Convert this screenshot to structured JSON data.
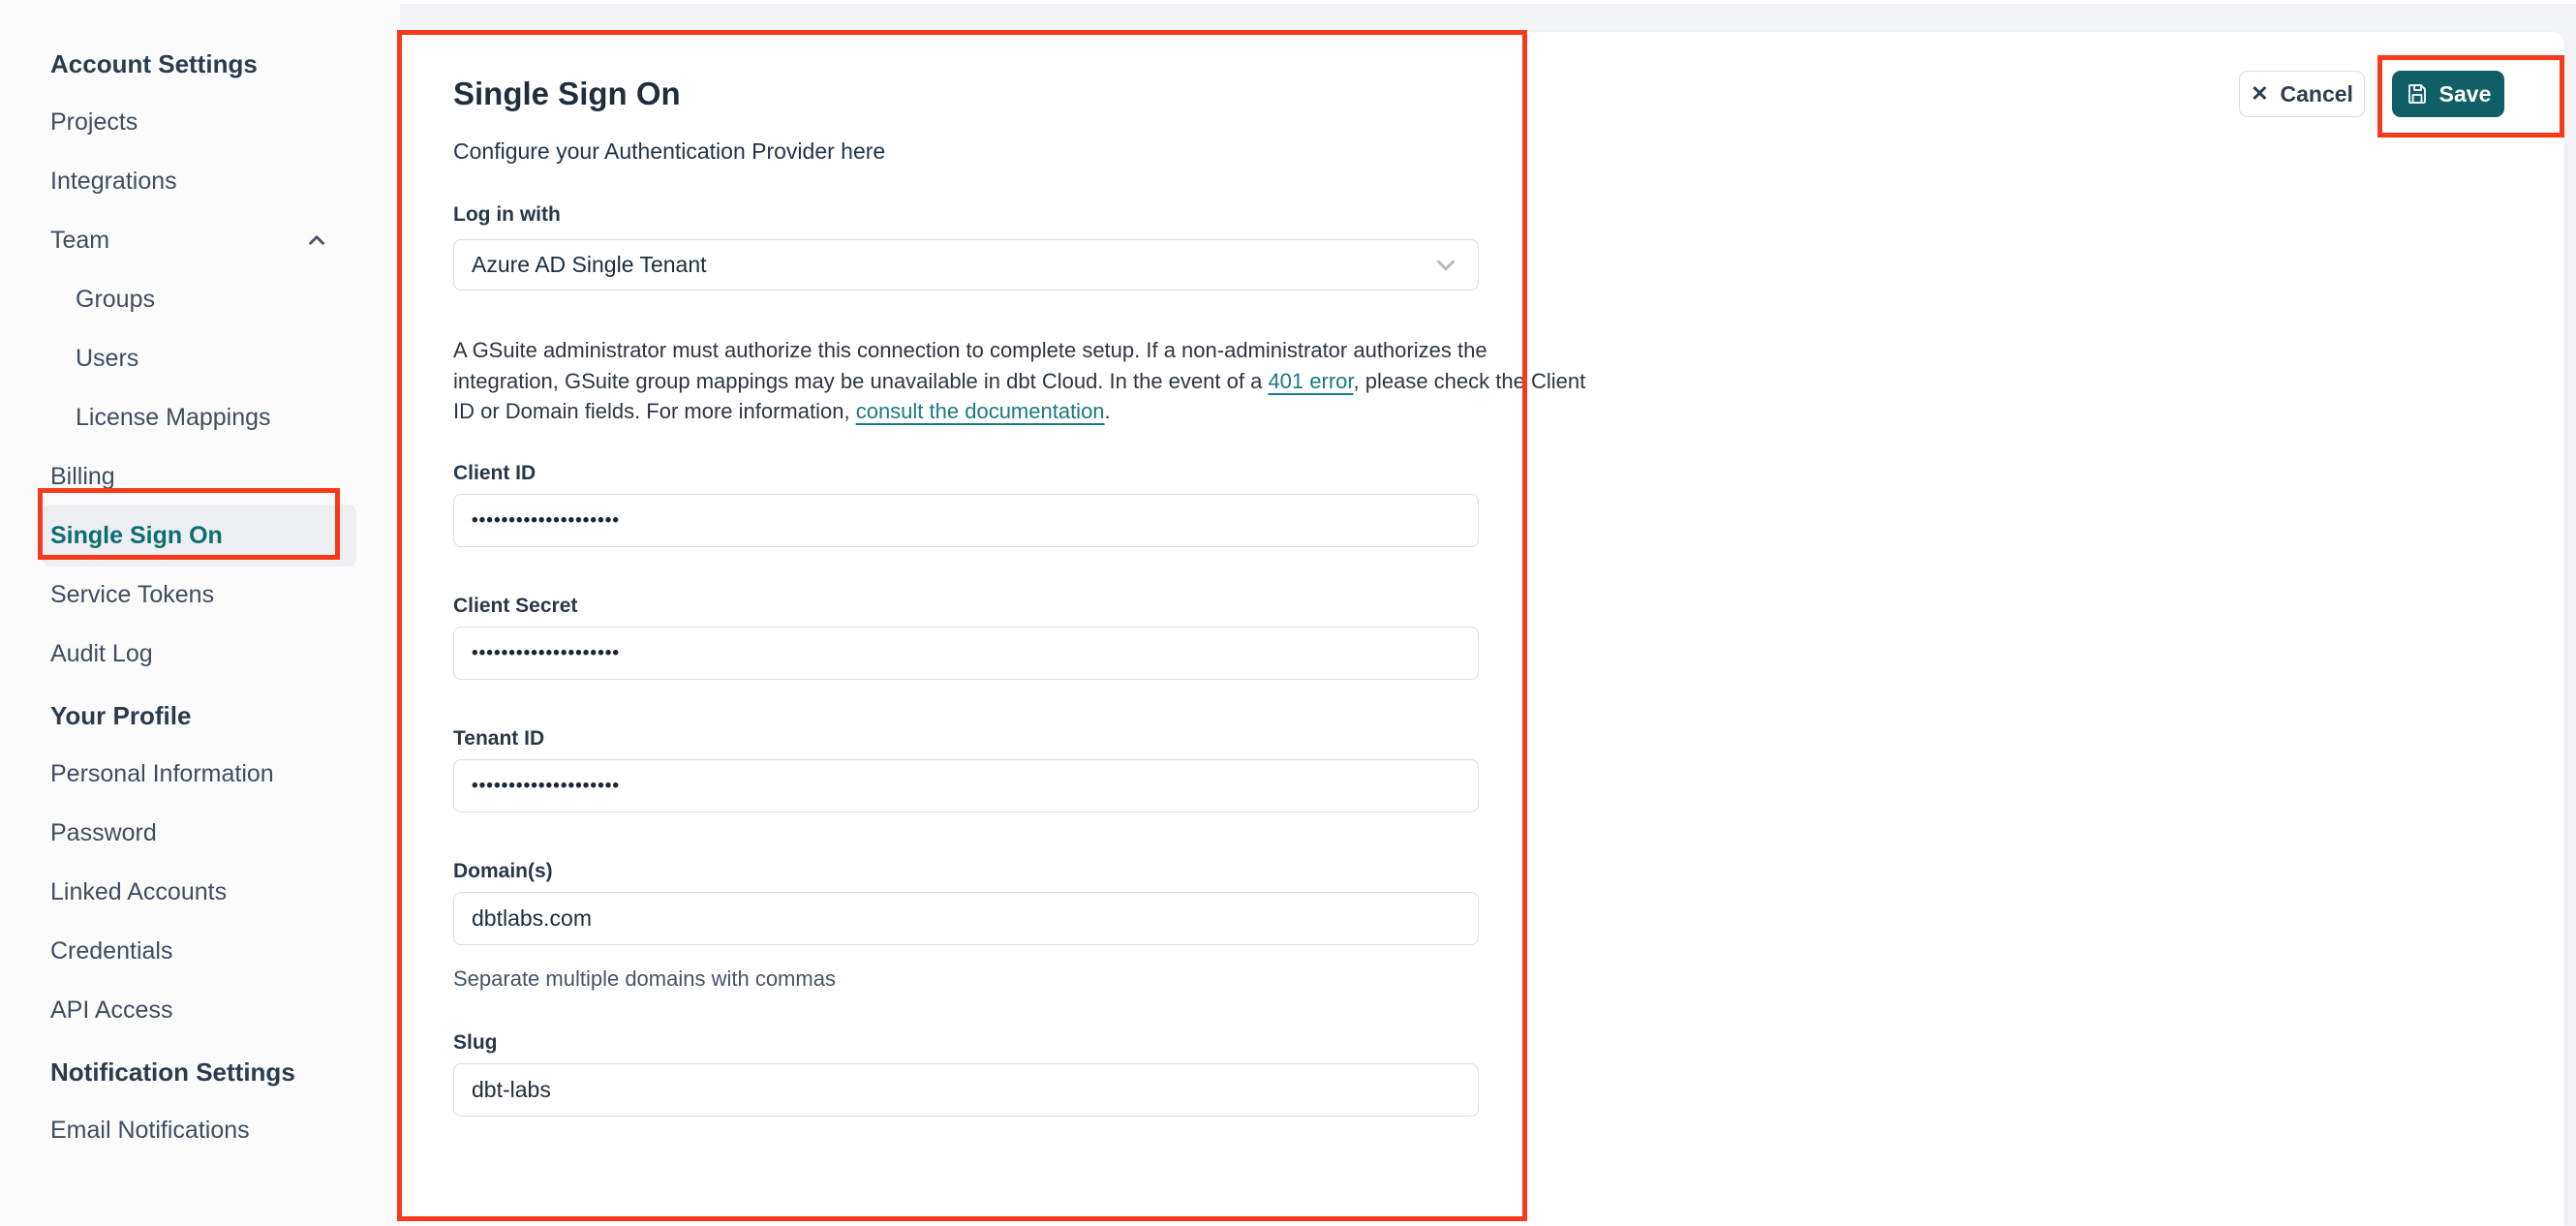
{
  "annotation_color": "#f53a1d",
  "sidebar": {
    "sections": [
      {
        "header": "Account Settings",
        "items": [
          {
            "label": "Projects"
          },
          {
            "label": "Integrations"
          },
          {
            "label": "Team",
            "chevron": "up"
          },
          {
            "label": "Groups",
            "indent": true
          },
          {
            "label": "Users",
            "indent": true
          },
          {
            "label": "License Mappings",
            "indent": true
          },
          {
            "label": "Billing"
          },
          {
            "label": "Single Sign On",
            "active": true
          },
          {
            "label": "Service Tokens"
          },
          {
            "label": "Audit Log"
          }
        ]
      },
      {
        "header": "Your Profile",
        "items": [
          {
            "label": "Personal Information"
          },
          {
            "label": "Password"
          },
          {
            "label": "Linked Accounts"
          },
          {
            "label": "Credentials"
          },
          {
            "label": "API Access"
          }
        ]
      },
      {
        "header": "Notification Settings",
        "items": [
          {
            "label": "Email Notifications"
          }
        ]
      }
    ]
  },
  "main": {
    "title": "Single Sign On",
    "subtitle": "Configure your Authentication Provider here",
    "login_with": {
      "label": "Log in with",
      "selected_value": "Azure AD Single Tenant"
    },
    "note_lines": [
      [
        {
          "t": "A GSuite administrator must authorize this connection to complete setup. If a non-administrator authorizes the"
        }
      ],
      [
        {
          "t": "integration, GSuite group mappings may be unavailable in dbt Cloud. In the event of a "
        },
        {
          "t": "401 error",
          "link": true
        },
        {
          "t": ", please check the Client"
        }
      ],
      [
        {
          "t": "ID or Domain fields. For more information, "
        },
        {
          "t": "consult the documentation",
          "link": true
        },
        {
          "t": "."
        }
      ]
    ],
    "fields": [
      {
        "label": "Client ID",
        "value": "••••••••••••••••••••",
        "masked": true
      },
      {
        "label": "Client Secret",
        "value": "••••••••••••••••••••",
        "masked": true
      },
      {
        "label": "Tenant ID",
        "value": "••••••••••••••••••••",
        "masked": true
      },
      {
        "label": "Domain(s)",
        "value": "dbtlabs.com",
        "helper": "Separate multiple domains with commas"
      },
      {
        "label": "Slug",
        "value": "dbt-labs"
      }
    ]
  },
  "toolbar": {
    "cancel_label": "Cancel",
    "save_label": "Save"
  },
  "colors": {
    "accent_teal": "#115f66",
    "active_link_teal": "#0d6e73",
    "annotation_red": "#f53a1d"
  }
}
